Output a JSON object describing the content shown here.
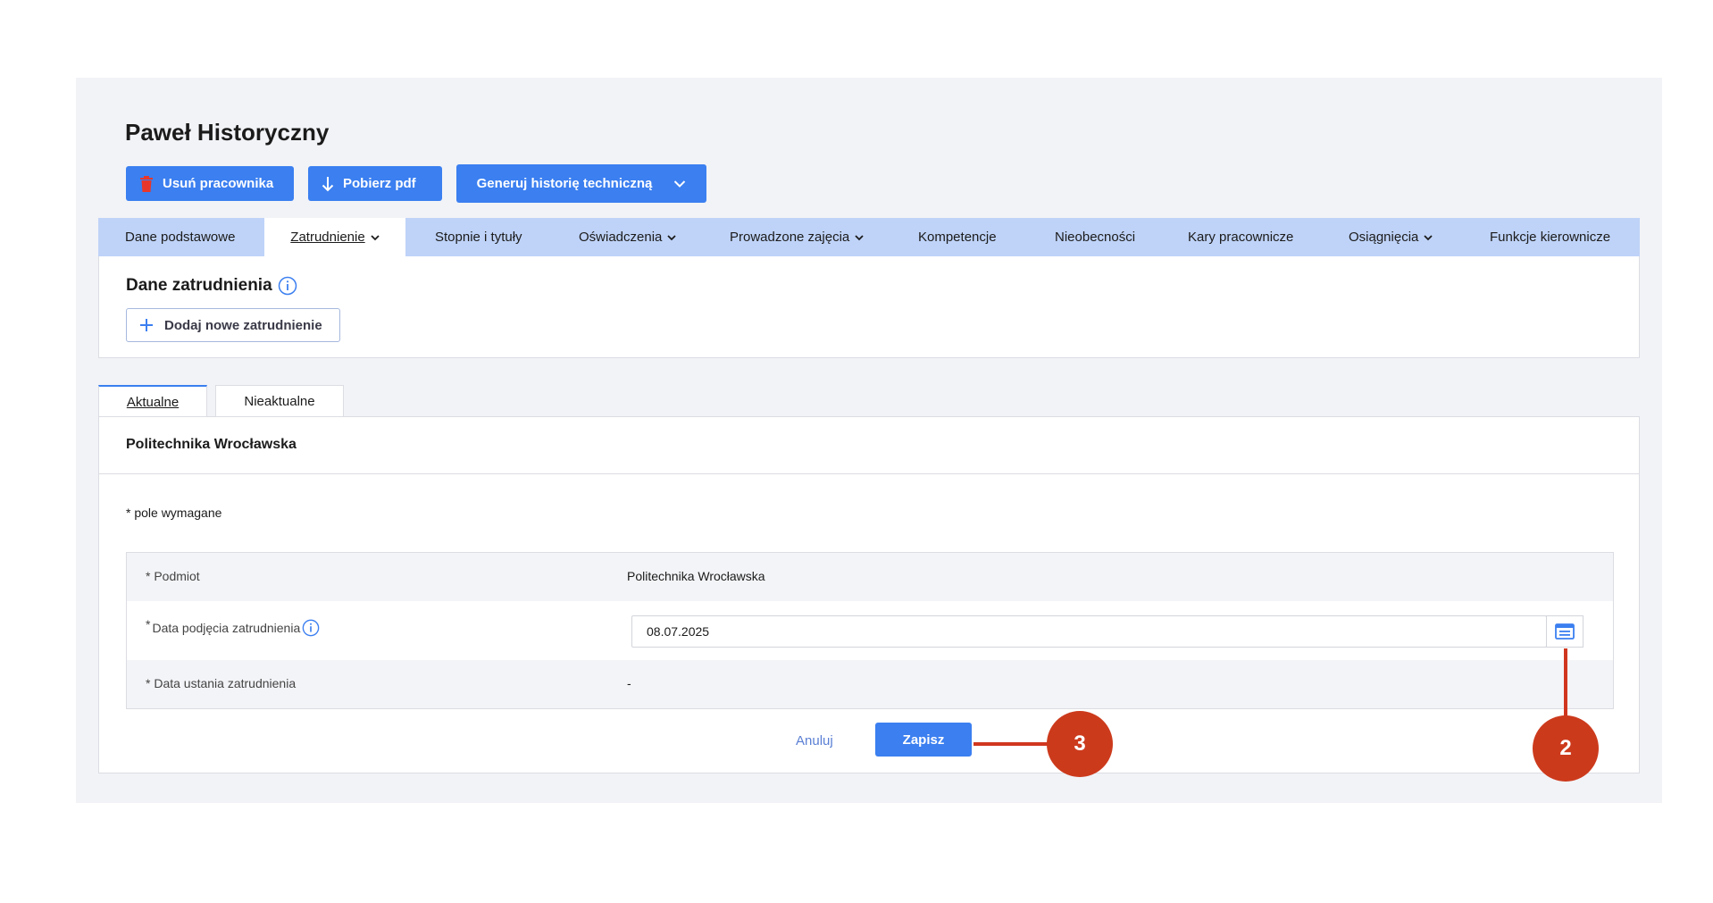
{
  "employee": {
    "name": "Paweł Historyczny"
  },
  "actions": {
    "delete_label": "Usuń pracownika",
    "pdf_label": "Pobierz pdf",
    "generate_label": "Generuj historię techniczną"
  },
  "tabs": [
    {
      "label": "Dane podstawowe",
      "dropdown": false,
      "active": false
    },
    {
      "label": "Zatrudnienie",
      "dropdown": true,
      "active": true
    },
    {
      "label": "Stopnie i tytuły",
      "dropdown": false,
      "active": false
    },
    {
      "label": "Oświadczenia",
      "dropdown": true,
      "active": false
    },
    {
      "label": "Prowadzone zajęcia",
      "dropdown": true,
      "active": false
    },
    {
      "label": "Kompetencje",
      "dropdown": false,
      "active": false
    },
    {
      "label": "Nieobecności",
      "dropdown": false,
      "active": false
    },
    {
      "label": "Kary pracownicze",
      "dropdown": false,
      "active": false
    },
    {
      "label": "Osiągnięcia",
      "dropdown": true,
      "active": false
    },
    {
      "label": "Funkcje kierownicze",
      "dropdown": false,
      "active": false
    }
  ],
  "section": {
    "title": "Dane zatrudnienia",
    "add_label": "Dodaj nowe zatrudnienie"
  },
  "subtabs": {
    "current": "Aktualne",
    "outdated": "Nieaktualne"
  },
  "employment": {
    "institution": "Politechnika Wrocławska",
    "required_note": "* pole wymagane",
    "fields": {
      "entity_label": "* Podmiot",
      "entity_value": "Politechnika Wrocławska",
      "start_label_star": "*",
      "start_label": "Data podjęcia zatrudnienia",
      "start_value": "08.07.2025",
      "end_label": "* Data ustania zatrudnienia",
      "end_value": "-"
    },
    "cancel_label": "Anuluj",
    "save_label": "Zapisz"
  },
  "callouts": {
    "save": "3",
    "calendar": "2"
  },
  "colors": {
    "primary": "#3b7ff0",
    "tabbar": "#bfd3f8",
    "callout": "#cc3a1c"
  }
}
